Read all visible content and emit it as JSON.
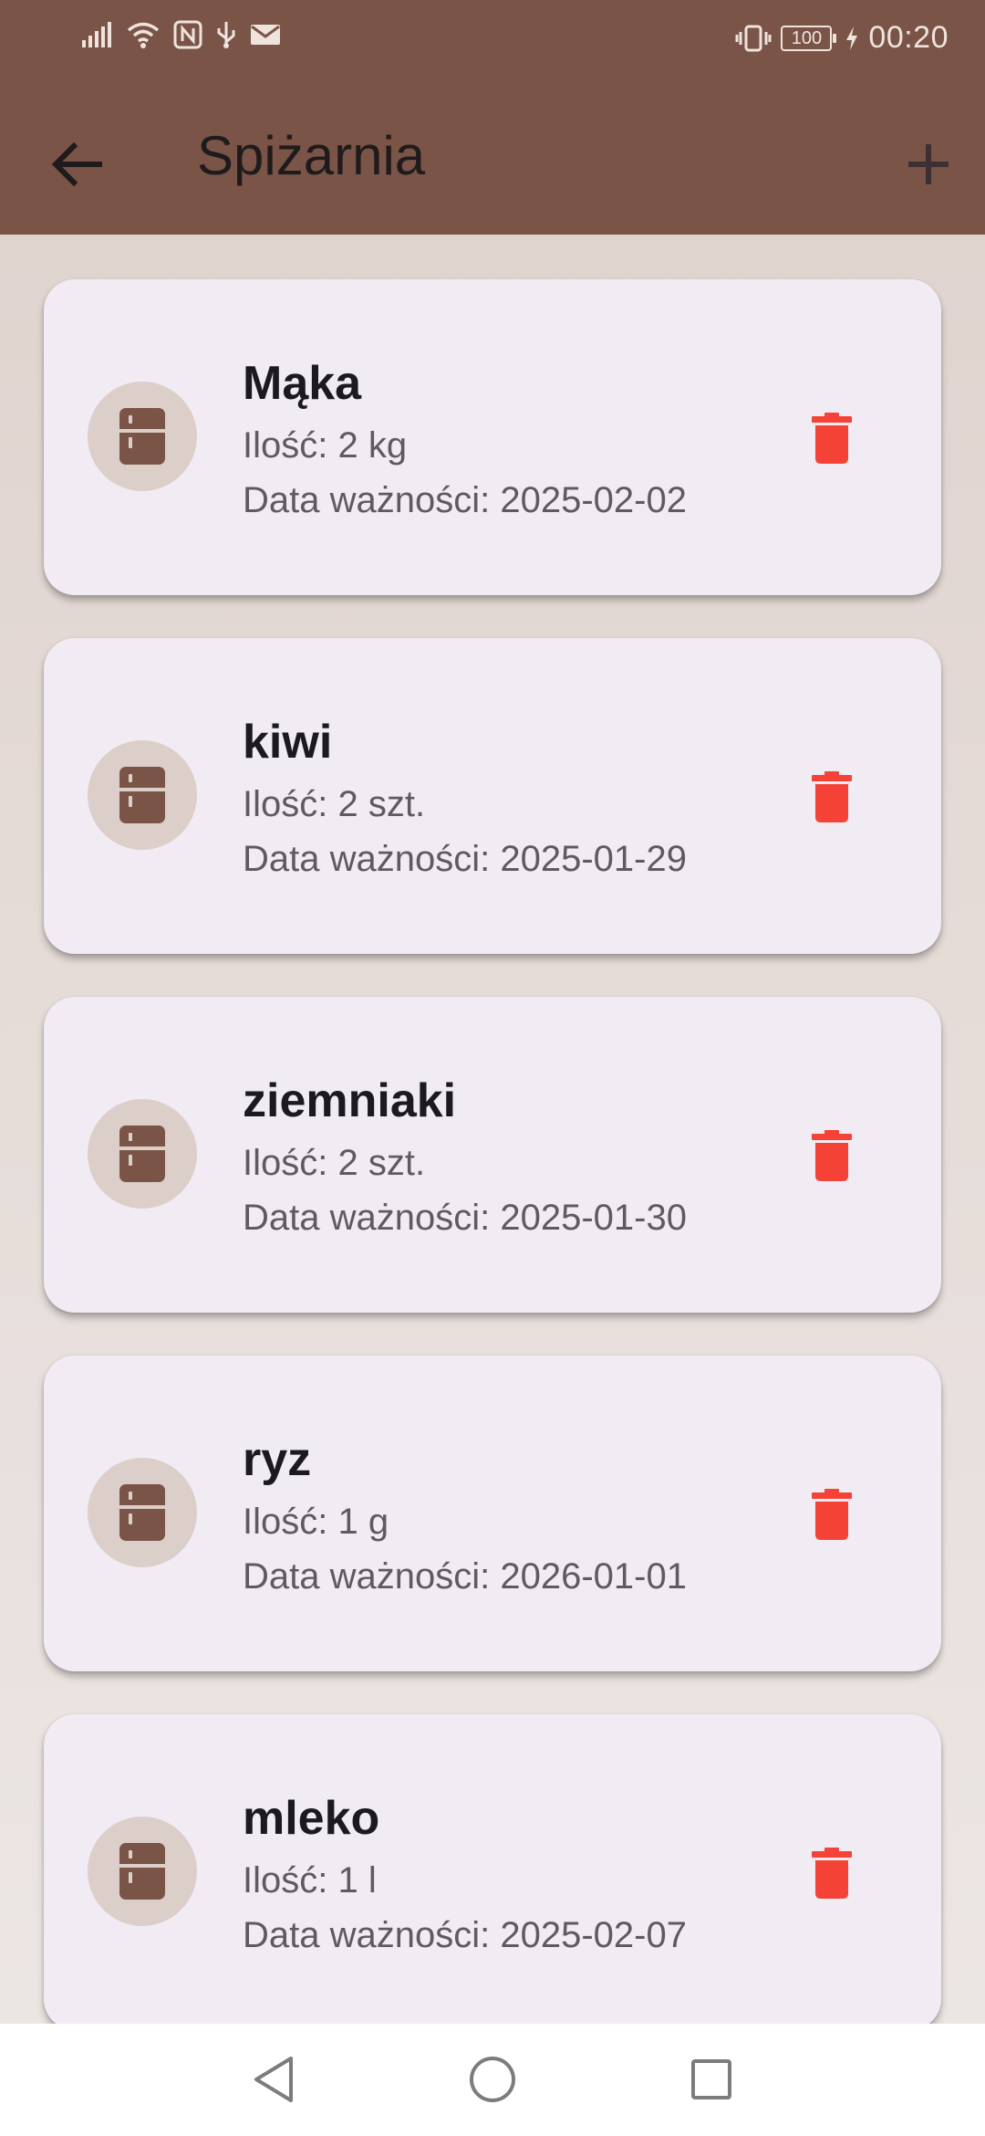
{
  "status_bar": {
    "time": "00:20",
    "battery_level": "100",
    "icons": [
      "signal-icon",
      "wifi-icon",
      "nfc-icon",
      "usb-icon",
      "mail-icon",
      "vibrate-icon",
      "battery-icon",
      "charging-icon"
    ]
  },
  "app_bar": {
    "title": "Spiżarnia",
    "back_icon": "arrow-back-icon",
    "add_icon": "plus-icon",
    "background_color": "#7a5446"
  },
  "pantry_items": [
    {
      "name": "Mąka",
      "quantity": "Ilość: 2 kg",
      "expiry": "Data ważności: 2025-02-02"
    },
    {
      "name": "kiwi",
      "quantity": "Ilość: 2 szt.",
      "expiry": "Data ważności: 2025-01-29"
    },
    {
      "name": "ziemniaki",
      "quantity": "Ilość: 2 szt.",
      "expiry": "Data ważności: 2025-01-30"
    },
    {
      "name": "ryz",
      "quantity": "Ilość: 1 g",
      "expiry": "Data ważności: 2026-01-01"
    },
    {
      "name": "mleko",
      "quantity": "Ilość: 1 l",
      "expiry": "Data ważności: 2025-02-07"
    }
  ],
  "colors": {
    "card_background": "#f1ecf4",
    "avatar_background": "#dccfca",
    "fridge_icon": "#7a5446",
    "delete_icon": "#f44336"
  },
  "nav_bar": {
    "icons": [
      "back-triangle-icon",
      "home-circle-icon",
      "recents-square-icon"
    ]
  }
}
